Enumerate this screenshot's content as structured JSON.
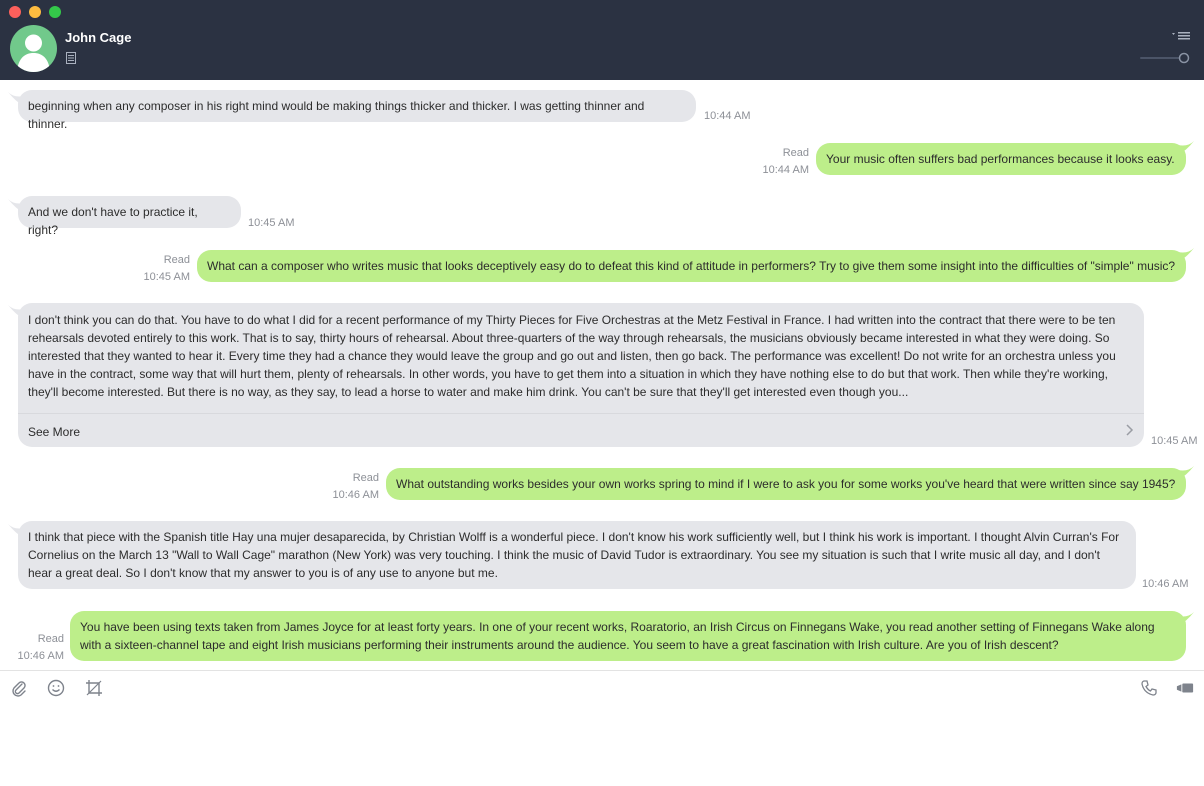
{
  "header": {
    "contact_name": "John Cage"
  },
  "messages": [
    {
      "direction": "in",
      "text": "beginning when any composer in his right mind would be making things thicker and thicker. I was getting thinner and thinner.",
      "time": "10:44 AM"
    },
    {
      "direction": "out",
      "status": "Read",
      "time": "10:44 AM",
      "text": "Your music often suffers bad performances because it looks easy."
    },
    {
      "direction": "in",
      "text": "And we don't have to practice it, right?",
      "time": "10:45 AM"
    },
    {
      "direction": "out",
      "status": "Read",
      "time": "10:45 AM",
      "text": "What can a composer who writes music that looks deceptively easy do to defeat this kind of attitude in performers? Try to give them some insight into the difficulties of \"simple\" music?"
    },
    {
      "direction": "in",
      "time": "10:45 AM",
      "lines": [
        "I don't think you can do that. You have to do what I did for a recent performance of my Thirty Pieces for Five Orchestras at the Metz Festival in France. I had written into the contract that there were to be ten",
        "rehearsals devoted entirely to this work. That is to say, thirty hours of rehearsal. About three-quarters of the way through rehearsals, the musicians obviously became interested in what they were doing. So",
        "interested that they wanted to hear it. Every time they had a chance they would leave the group and go out and listen, then go back. The performance was excellent! Do not write for an orchestra unless you",
        "have in the contract, some way that will hurt them, plenty of rehearsals. In other words, you have to get them into a situation in which they have nothing else to do but that work. Then while they're working,",
        "they'll become interested. But there is no way, as they say, to lead a horse to water and make him drink. You can't be sure that they'll get interested even though you..."
      ],
      "see_more": "See More"
    },
    {
      "direction": "out",
      "status": "Read",
      "time": "10:46 AM",
      "text": "What outstanding works besides your own works spring to mind if I were to ask you for some works you've heard that were written since say 1945?"
    },
    {
      "direction": "in",
      "time": "10:46 AM",
      "lines": [
        "I think that piece with the Spanish title Hay una mujer desaparecida, by Christian Wolff is a wonderful piece. I don't know his work sufficiently well, but I think his work is important. I thought Alvin Curran's For",
        "Cornelius on the March 13 \"Wall to Wall Cage\" marathon (New York) was very touching. I think the music of David Tudor is extraordinary. You see my situation is such that I write music all day, and I don't",
        "hear a great deal. So I don't know that my answer to you is of any use to anyone but me."
      ]
    },
    {
      "direction": "out",
      "status": "Read",
      "time": "10:46 AM",
      "lines": [
        "You have been using texts taken from James Joyce for at least forty years. In one of your recent works, Roaratorio, an Irish Circus on Finnegans Wake, you read another setting of Finnegans Wake along",
        "with a sixteen-channel tape and eight Irish musicians performing their instruments around the audience. You seem to have a great fascination with Irish culture. Are you of Irish descent?"
      ]
    }
  ],
  "toolbar": {
    "left_icons": [
      "paperclip-icon",
      "emoji-icon",
      "crop-icon"
    ],
    "right_icons": [
      "phone-icon",
      "video-icon"
    ]
  },
  "colors": {
    "header_bg": "#2b3242",
    "incoming_bubble": "#e5e6ea",
    "outgoing_bubble": "#bdee8a",
    "avatar": "#71c98b"
  }
}
